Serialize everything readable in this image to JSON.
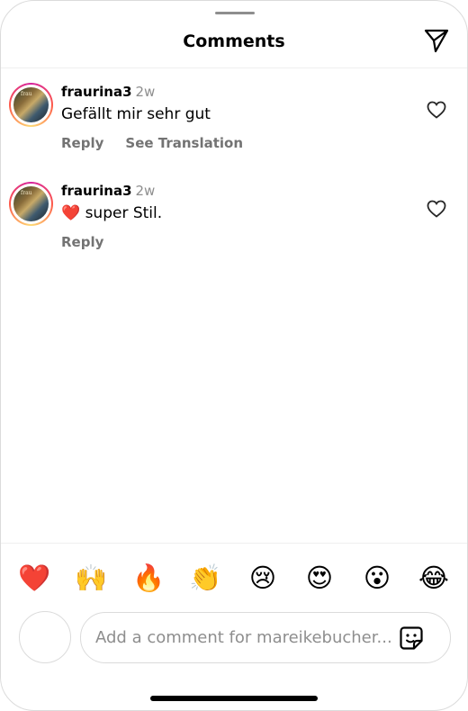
{
  "header": {
    "title": "Comments",
    "share_icon": "send-icon"
  },
  "comments": [
    {
      "username": "fraurina3",
      "time": "2w",
      "text": "Gefällt mir sehr gut",
      "reply": "Reply",
      "translation": "See Translation",
      "avatar_text": "frau"
    },
    {
      "username": "fraurina3",
      "time": "2w",
      "text": "❤️ super Stil.",
      "reply": "Reply",
      "avatar_text": "frau"
    }
  ],
  "emoji_bar": [
    "❤️",
    "🙌",
    "🔥",
    "👏",
    "😢",
    "😍",
    "😮",
    "😂"
  ],
  "composer": {
    "placeholder": "Add a comment for mareikebucher...",
    "sticker_icon": "sticker-icon"
  },
  "colors": {
    "text": "#000000",
    "secondary": "#737373",
    "muted": "#8e8e8e",
    "border": "#dbdbdb"
  }
}
